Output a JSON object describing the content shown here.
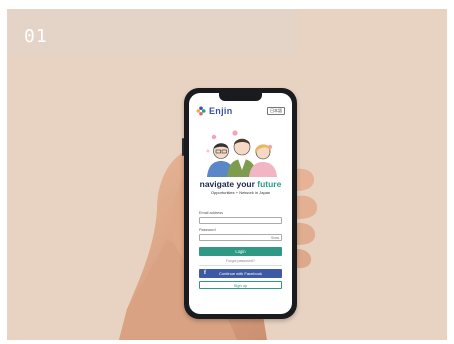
{
  "slide": {
    "number": "01"
  },
  "colors": {
    "background": "#e8d3c2",
    "accent_teal": "#2f9986",
    "brand_blue": "#3a52a6",
    "facebook_blue": "#3e5aa4"
  },
  "app": {
    "brand_name": "Enjin",
    "language_button": "日本語",
    "headline_prefix": "navigate your ",
    "headline_accent": "future",
    "tagline": "Opportunities + Network in Japan"
  },
  "login_form": {
    "email_label": "Email address",
    "email_value": "",
    "password_label": "Password",
    "password_value": "",
    "show_toggle": "Show",
    "login_button": "Login",
    "forgot_link": "Forgot password?",
    "facebook_button": "Continue with Facebook",
    "facebook_icon": "f",
    "signup_button": "Sign up"
  },
  "icons": {
    "logo": "enjin-flower-logo-icon",
    "facebook": "facebook-icon"
  }
}
